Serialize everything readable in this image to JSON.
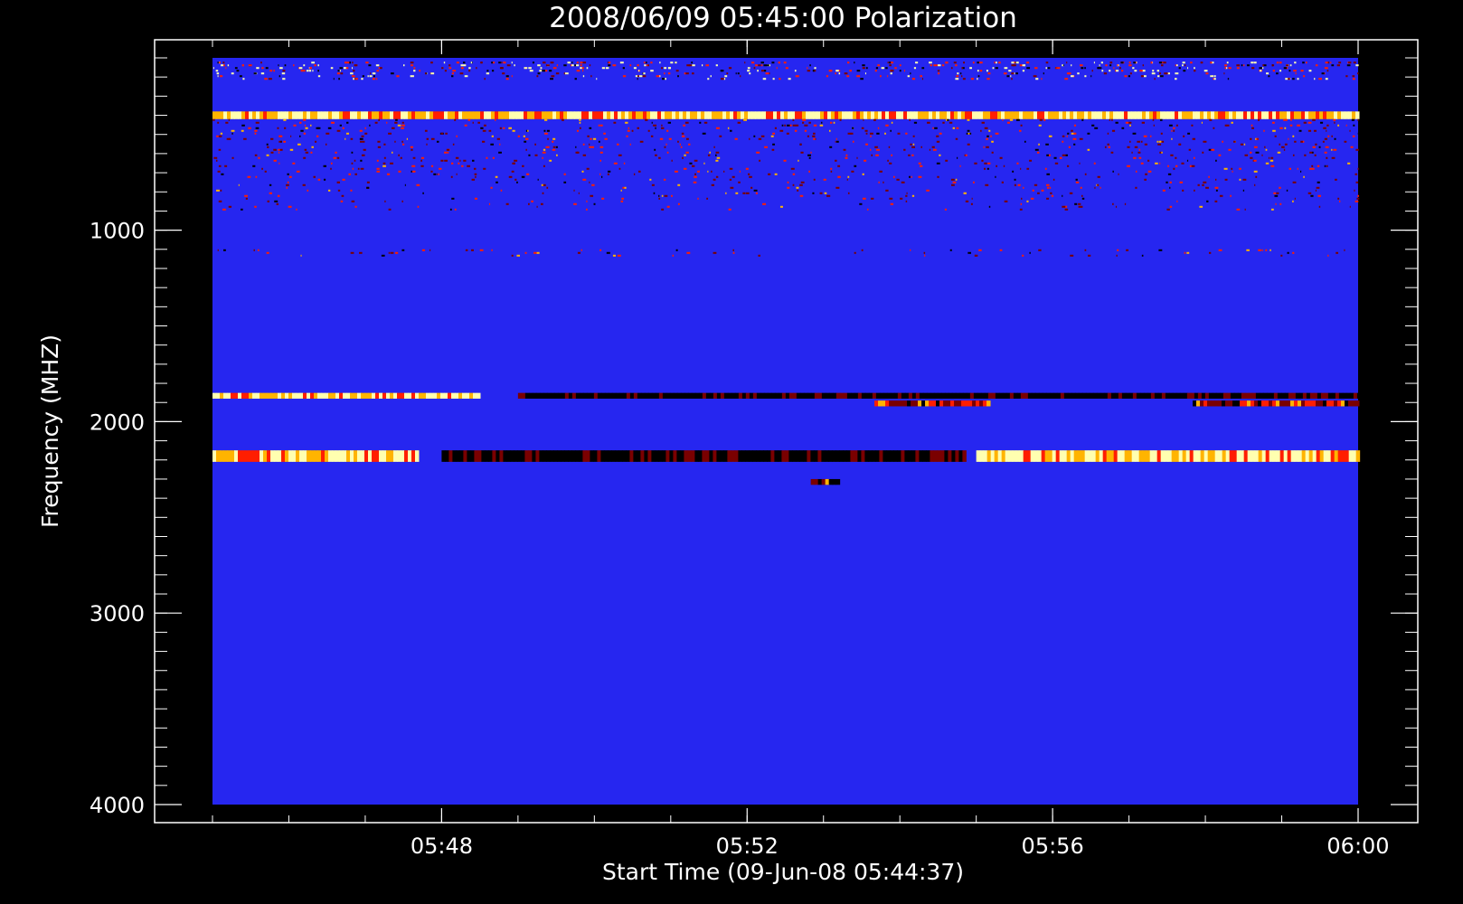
{
  "chart_data": {
    "type": "heatmap",
    "title": "2008/06/09 05:45:00 Polarization",
    "xlabel": "Start Time (09-Jun-08 05:44:37)",
    "ylabel": "Frequency (MHZ)",
    "x_range": [
      "05:45:00",
      "06:00:00"
    ],
    "y_range": [
      100,
      4000
    ],
    "y_inverted": true,
    "x_ticks": [
      "05:48",
      "05:52",
      "05:56",
      "06:00"
    ],
    "y_ticks": [
      1000,
      2000,
      3000,
      4000
    ],
    "background_color": "#2626f0",
    "palette": [
      "#000000",
      "#7a0000",
      "#ff1e00",
      "#ffb400",
      "#ffffb0"
    ],
    "features": [
      {
        "y": [
          120,
          220
        ],
        "x": [
          "05:45:00",
          "06:00:00"
        ],
        "kind": "noise",
        "level": "high"
      },
      {
        "y": [
          380,
          420
        ],
        "x": [
          "05:45:00",
          "06:00:00"
        ],
        "kind": "band",
        "level": "bright"
      },
      {
        "y": [
          420,
          900
        ],
        "x": [
          "05:45:00",
          "06:00:00"
        ],
        "kind": "noise",
        "level": "medium"
      },
      {
        "y": [
          1100,
          1140
        ],
        "x": [
          "05:45:00",
          "06:00:00"
        ],
        "kind": "speckle",
        "level": "medium"
      },
      {
        "y": [
          1850,
          1880
        ],
        "x": [
          "05:45:00",
          "05:48:30"
        ],
        "kind": "band",
        "level": "bright"
      },
      {
        "y": [
          1850,
          1880
        ],
        "x": [
          "05:49:00",
          "06:00:00"
        ],
        "kind": "band",
        "level": "dark"
      },
      {
        "y": [
          1890,
          1920
        ],
        "x": [
          "05:53:40",
          "05:55:10"
        ],
        "kind": "band",
        "level": "medium"
      },
      {
        "y": [
          1890,
          1920
        ],
        "x": [
          "05:57:50",
          "06:00:00"
        ],
        "kind": "band",
        "level": "medium"
      },
      {
        "y": [
          2150,
          2210
        ],
        "x": [
          "05:45:00",
          "05:47:40"
        ],
        "kind": "band",
        "level": "bright"
      },
      {
        "y": [
          2150,
          2210
        ],
        "x": [
          "05:48:00",
          "05:54:50"
        ],
        "kind": "band",
        "level": "dark"
      },
      {
        "y": [
          2150,
          2210
        ],
        "x": [
          "05:55:00",
          "06:00:00"
        ],
        "kind": "band",
        "level": "bright"
      },
      {
        "y": [
          2300,
          2330
        ],
        "x": [
          "05:52:50",
          "05:53:10"
        ],
        "kind": "spot",
        "level": "medium"
      }
    ]
  }
}
